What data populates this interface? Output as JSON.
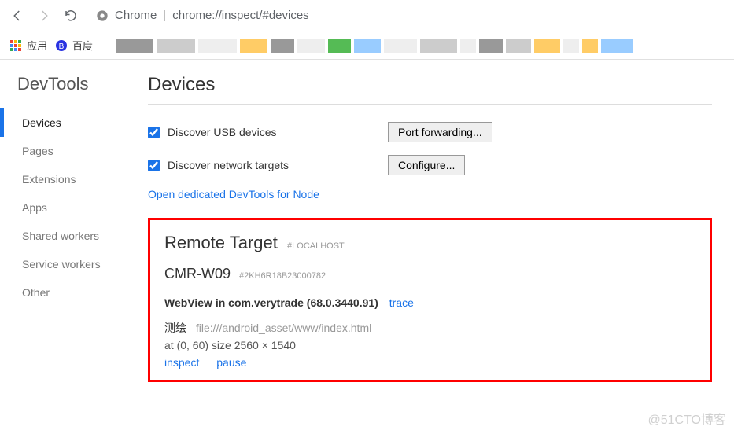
{
  "toolbar": {
    "site_label": "Chrome",
    "url": "chrome://inspect/#devices"
  },
  "bookmarks": {
    "apps": "应用",
    "baidu": "百度",
    "strip_colors": [
      "#999",
      "#ccc",
      "#eee",
      "#fc6",
      "#999",
      "#eee",
      "#5b5",
      "#9cf",
      "#eee",
      "#ccc",
      "#eee",
      "#999",
      "#ccc",
      "#fc6",
      "#eee",
      "#fc6",
      "#9cf"
    ]
  },
  "sidebar": {
    "title": "DevTools",
    "items": [
      {
        "label": "Devices",
        "active": true
      },
      {
        "label": "Pages"
      },
      {
        "label": "Extensions"
      },
      {
        "label": "Apps"
      },
      {
        "label": "Shared workers"
      },
      {
        "label": "Service workers"
      },
      {
        "label": "Other"
      }
    ]
  },
  "main": {
    "title": "Devices",
    "discover_usb": "Discover USB devices",
    "port_forwarding": "Port forwarding...",
    "discover_net": "Discover network targets",
    "configure": "Configure...",
    "node_link": "Open dedicated DevTools for Node"
  },
  "remote": {
    "heading": "Remote Target",
    "tag": "#LOCALHOST",
    "device_name": "CMR-W09",
    "device_serial": "#2KH6R18B23000782",
    "webview_label": "WebView in com.verytrade (68.0.3440.91)",
    "trace": "trace",
    "page_title": "测绘",
    "page_url": "file:///android_asset/www/index.html",
    "page_meta": "at (0, 60)  size 2560 × 1540",
    "inspect": "inspect",
    "pause": "pause"
  },
  "watermark": "@51CTO博客"
}
